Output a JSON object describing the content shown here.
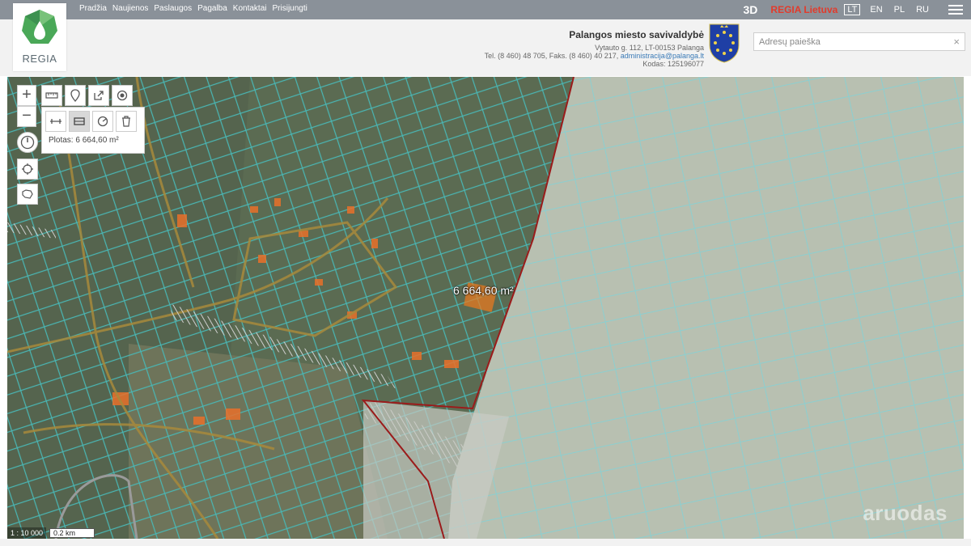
{
  "topnav": {
    "items": [
      "Pradžia",
      "Naujienos",
      "Paslaugos",
      "Pagalba",
      "Kontaktai",
      "Prisijungti"
    ],
    "btn_3d": "3D",
    "regia_lt": "REGIA Lietuva",
    "langs": [
      "LT",
      "EN",
      "PL",
      "RU"
    ],
    "active_lang": "LT"
  },
  "logo": {
    "text": "REGIA"
  },
  "municipality": {
    "name": "Palangos miesto savivaldybė",
    "address": "Vytauto g. 112, LT-00153 Palanga",
    "phone": "Tel. (8 460) 48 705, Faks. (8 460) 40 217,",
    "email": "administracija@palanga.lt",
    "code": "Kodas: 125196077"
  },
  "search": {
    "placeholder": "Adresų paieška",
    "value": "",
    "clear_icon": "×"
  },
  "map": {
    "area_panel_text": "Plotas: 6 664,60 m²",
    "measure_label": "6 664,60 m²",
    "scale_ratio": "1 : 10 000",
    "scale_bar": "0.2 km",
    "watermark": "aruodas",
    "colors": {
      "parcel": "#49b6b4",
      "boundary": "#9b1b1b",
      "highlight": "#f07a1c",
      "road": "#a88a3c"
    }
  }
}
